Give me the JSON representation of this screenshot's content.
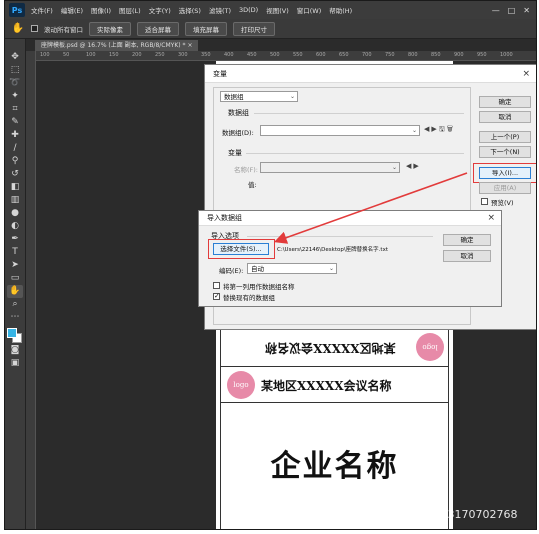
{
  "app": {
    "logo": "Ps",
    "menu": [
      "文件(F)",
      "编辑(E)",
      "图像(I)",
      "图层(L)",
      "文字(Y)",
      "选择(S)",
      "滤镜(T)",
      "3D(D)",
      "视图(V)",
      "窗口(W)",
      "帮助(H)"
    ],
    "window_controls": [
      "—",
      "□",
      "✕"
    ]
  },
  "options_bar": {
    "tool_icon": "hand-icon",
    "scroll_all_label": "滚动所有窗口",
    "buttons": [
      "实际像素",
      "适合屏幕",
      "填充屏幕",
      "打印尺寸"
    ]
  },
  "document_tab": {
    "label": "座牌模板.psd @ 16.7% (上面 副本, RGB/8/CMYK) *",
    "close": "×"
  },
  "ruler_ticks": [
    "100",
    "50",
    "100",
    "150",
    "200",
    "250",
    "300",
    "350",
    "400",
    "450",
    "500",
    "550",
    "600",
    "650",
    "700",
    "750",
    "800",
    "850",
    "900",
    "950",
    "1000"
  ],
  "variables_dialog": {
    "title": "变量",
    "close": "×",
    "top_select": "数据组",
    "dataset_group": "数据组",
    "dataset_label": "数据组(D):",
    "variables_group": "变量",
    "name_label": "名称(F):",
    "value_label": "值:",
    "buttons": {
      "ok": "确定",
      "cancel": "取消",
      "prev": "上一个(P)",
      "next": "下一个(N)",
      "import": "导入(I)...",
      "apply": "应用(A)"
    },
    "preview_label": "预览(V)"
  },
  "import_dialog": {
    "title": "导入数据组",
    "close": "×",
    "options_group": "导入选项",
    "choose_file": "选择文件(S)...",
    "file_path": "C:\\Users\\22146\\Desktop\\座牌替换名字.txt",
    "encoding_label": "编码(E):",
    "encoding_value": "自动",
    "first_col_label": "将第一列用作数据组名称",
    "replace_label": "替换现有的数据组",
    "ok": "确定",
    "cancel": "取消"
  },
  "canvas": {
    "logo_text": "logo",
    "card_title": "某地区XXXXX会议名称",
    "company_name": "企业名称"
  },
  "watermark": "https://blog.csdn.net/weixin_43170702768",
  "colors": {
    "foreground": "#36b4e5",
    "logo_pink": "#e78aa8",
    "annotation_red": "#e23b3b"
  }
}
